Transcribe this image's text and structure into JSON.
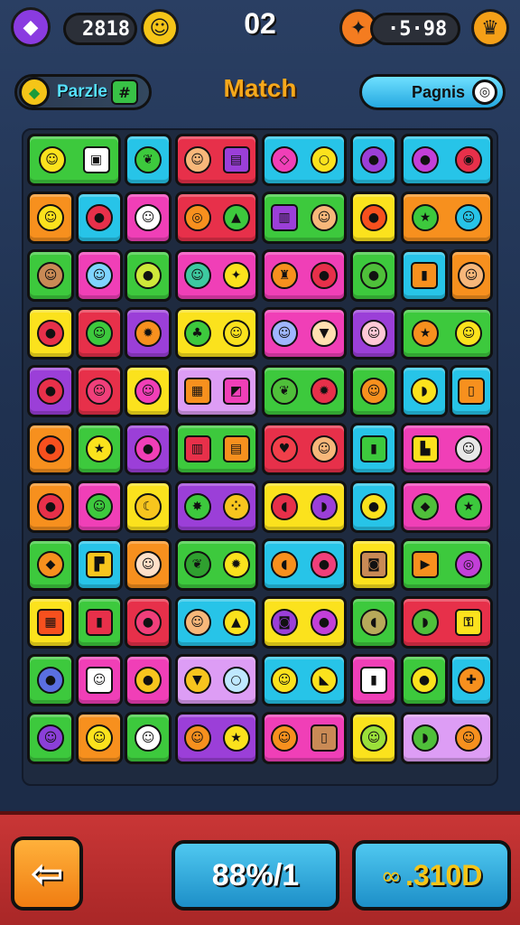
{
  "top_bar": {
    "left_icon": "blue-gem-icon",
    "counter_left": "2818",
    "coin_icon": "coin-icon",
    "level_number": "02",
    "right_icon": "orange-fruit-icon",
    "counter_right": "·5·98",
    "menu_icon": "crown-icon"
  },
  "sub_bar": {
    "puzzle_label": "Parzle",
    "puzzle_badge_icon": "grid-icon",
    "title": "Match",
    "right_button_label": "Pagnis",
    "right_button_icon": "ring-icon"
  },
  "colors": {
    "green": "#3dc93d",
    "cyan": "#27c4e8",
    "red": "#e7304a",
    "pink": "#f03fb7",
    "yellow": "#fbe21d",
    "orange": "#f7901e",
    "purple": "#9b3fd8",
    "lavender": "#dd9df5",
    "lime": "#9be03a"
  },
  "bottom_bar": {
    "back_icon": "back-arrow-icon",
    "score_label": "88%/1",
    "coins_icon": "link-icon",
    "coins_label": ".310D"
  }
}
